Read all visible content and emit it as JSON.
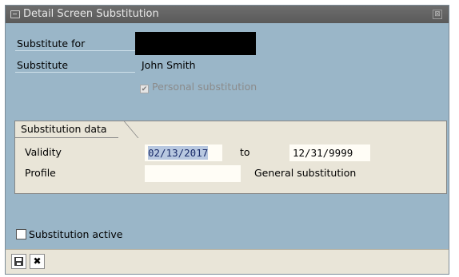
{
  "window": {
    "title": "Detail Screen Substitution",
    "close_glyph": "⊠"
  },
  "form": {
    "substitute_for_label": "Substitute for",
    "substitute_for_value": "",
    "substitute_label": "Substitute",
    "substitute_value": "John Smith",
    "personal_substitution_label": "Personal substitution",
    "personal_substitution_checked": true
  },
  "substitution_data": {
    "group_title": "Substitution data",
    "validity_label": "Validity",
    "validity_from": "02/13/2017",
    "to_label": "to",
    "validity_to": "12/31/9999",
    "profile_label": "Profile",
    "profile_value": "",
    "profile_text": "General substitution"
  },
  "substitution_active": {
    "label": "Substitution active",
    "checked": false
  },
  "toolbar": {
    "save_icon": "floppy-disk-icon",
    "cancel_icon": "cancel-x-icon",
    "cancel_glyph": "✖"
  },
  "colors": {
    "background": "#9ab6c8",
    "group_background": "#e9e5d8",
    "title_bar": "#5a5a5a"
  }
}
